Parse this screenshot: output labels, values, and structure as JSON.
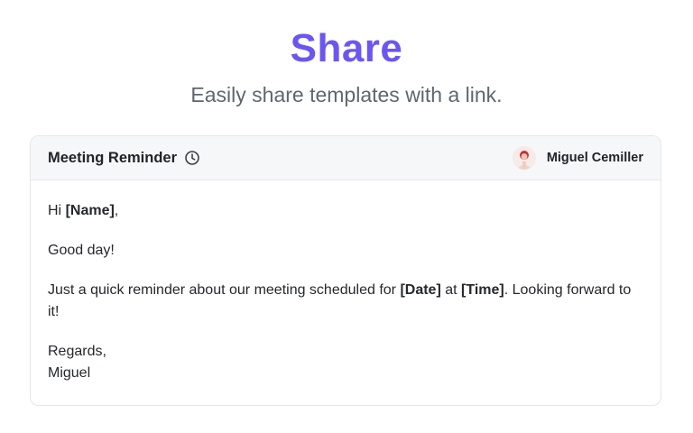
{
  "hero": {
    "title": "Share",
    "subtitle": "Easily share templates with a link."
  },
  "template": {
    "title": "Meeting Reminder",
    "icon": "clock-icon",
    "author": {
      "name": "Miguel Cemiller",
      "avatar": "avatar"
    },
    "body": {
      "greeting_prefix": "Hi ",
      "name_placeholder": "[Name]",
      "greeting_suffix": ",",
      "line2": "Good day!",
      "line3_prefix": "Just a quick reminder about our meeting scheduled for ",
      "date_placeholder": "[Date]",
      "line3_mid": " at ",
      "time_placeholder": "[Time]",
      "line3_suffix": ". Looking forward to it!",
      "closing": "Regards,",
      "signature": "Miguel"
    }
  },
  "colors": {
    "accent": "#6b57f0",
    "subtitle": "#5f6670",
    "header_bg": "#f6f7f9",
    "border": "#e4e7ec"
  }
}
